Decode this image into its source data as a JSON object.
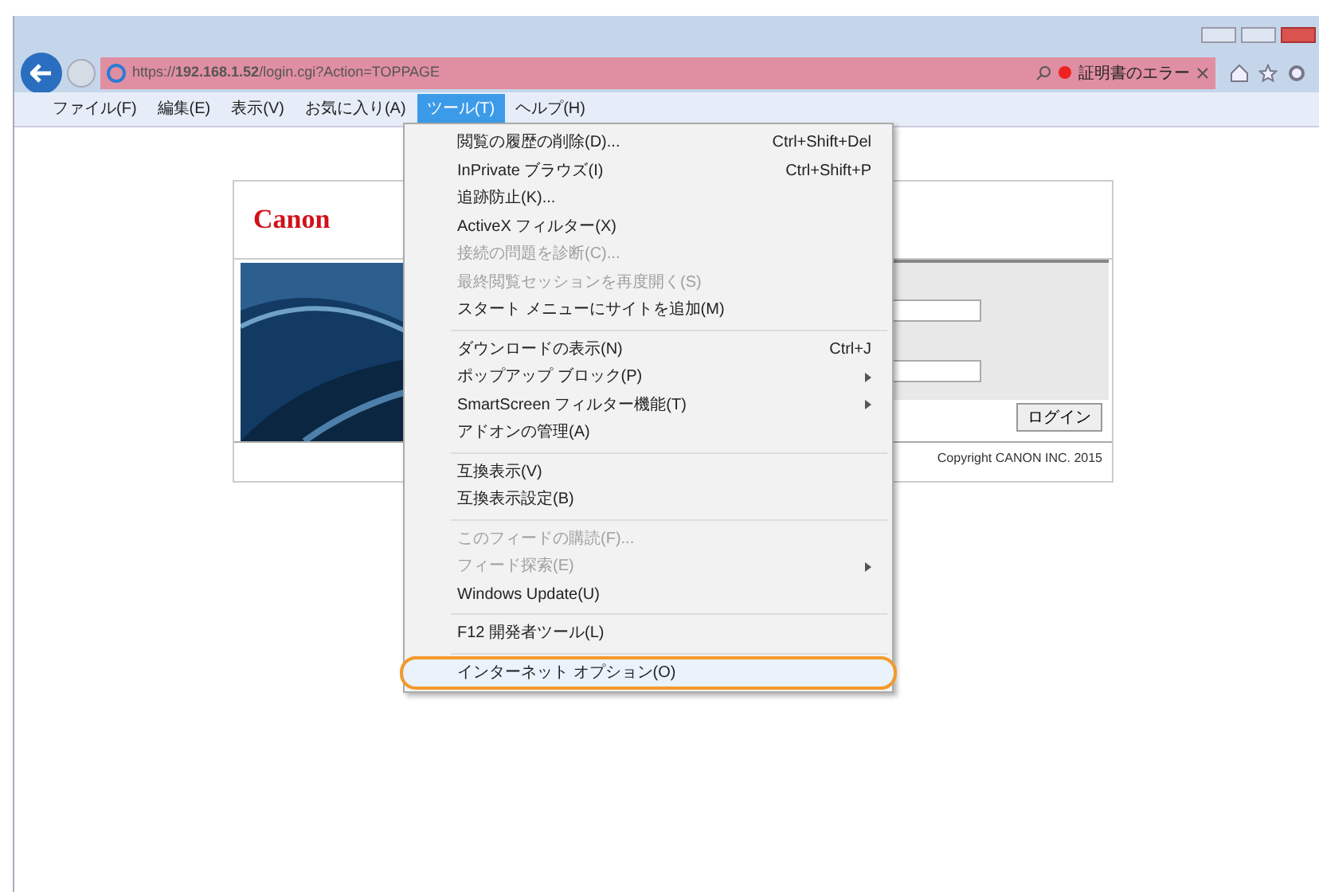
{
  "browser": {
    "address": "https://**192.168.1.52**/login.cgi?Action=TOPPAGE",
    "certificate_error": "証明書のエラー"
  },
  "menu_bar": [
    {
      "label": "ファイル(F)",
      "selected": false
    },
    {
      "label": "編集(E)",
      "selected": false
    },
    {
      "label": "表示(V)",
      "selected": false
    },
    {
      "label": "お気に入り(A)",
      "selected": false
    },
    {
      "label": "ツール(T)",
      "selected": true
    },
    {
      "label": "ヘルプ(H)",
      "selected": false
    }
  ],
  "page": {
    "logo": "Canon",
    "login_button": "ログイン",
    "copyright": "Copyright CANON INC. 2015"
  },
  "tools_menu": {
    "groups": [
      {
        "items": [
          {
            "label": "閲覧の履歴の削除(D)...",
            "shortcut": "Ctrl+Shift+Del",
            "disabled": false,
            "submenu": false,
            "selected": false
          },
          {
            "label": "InPrivate ブラウズ(I)",
            "shortcut": "Ctrl+Shift+P",
            "disabled": false,
            "submenu": false,
            "selected": false
          },
          {
            "label": "追跡防止(K)...",
            "disabled": false,
            "submenu": false,
            "selected": false
          },
          {
            "label": "ActiveX フィルター(X)",
            "disabled": false,
            "submenu": false,
            "selected": false
          },
          {
            "label": "接続の問題を診断(C)...",
            "disabled": true,
            "submenu": false,
            "selected": false
          },
          {
            "label": "最終閲覧セッションを再度開く(S)",
            "disabled": true,
            "submenu": false,
            "selected": false
          },
          {
            "label": "スタート メニューにサイトを追加(M)",
            "disabled": false,
            "submenu": false,
            "selected": false
          }
        ]
      },
      {
        "items": [
          {
            "label": "ダウンロードの表示(N)",
            "shortcut": "Ctrl+J",
            "disabled": false,
            "submenu": false,
            "selected": false
          },
          {
            "label": "ポップアップ ブロック(P)",
            "disabled": false,
            "submenu": true,
            "selected": false
          },
          {
            "label": "SmartScreen フィルター機能(T)",
            "disabled": false,
            "submenu": true,
            "selected": false
          },
          {
            "label": "アドオンの管理(A)",
            "disabled": false,
            "submenu": false,
            "selected": false
          }
        ]
      },
      {
        "items": [
          {
            "label": "互換表示(V)",
            "disabled": false,
            "submenu": false,
            "selected": false
          },
          {
            "label": "互換表示設定(B)",
            "disabled": false,
            "submenu": false,
            "selected": false
          }
        ]
      },
      {
        "items": [
          {
            "label": "このフィードの購読(F)...",
            "disabled": true,
            "submenu": false,
            "selected": false
          },
          {
            "label": "フィード探索(E)",
            "disabled": true,
            "submenu": true,
            "selected": false
          },
          {
            "label": "Windows Update(U)",
            "disabled": false,
            "submenu": false,
            "selected": false
          }
        ]
      },
      {
        "items": [
          {
            "label": "F12 開発者ツール(L)",
            "disabled": false,
            "submenu": false,
            "selected": false
          }
        ]
      },
      {
        "items": [
          {
            "label": "インターネット オプション(O)",
            "disabled": false,
            "submenu": false,
            "selected": true
          }
        ]
      }
    ]
  }
}
